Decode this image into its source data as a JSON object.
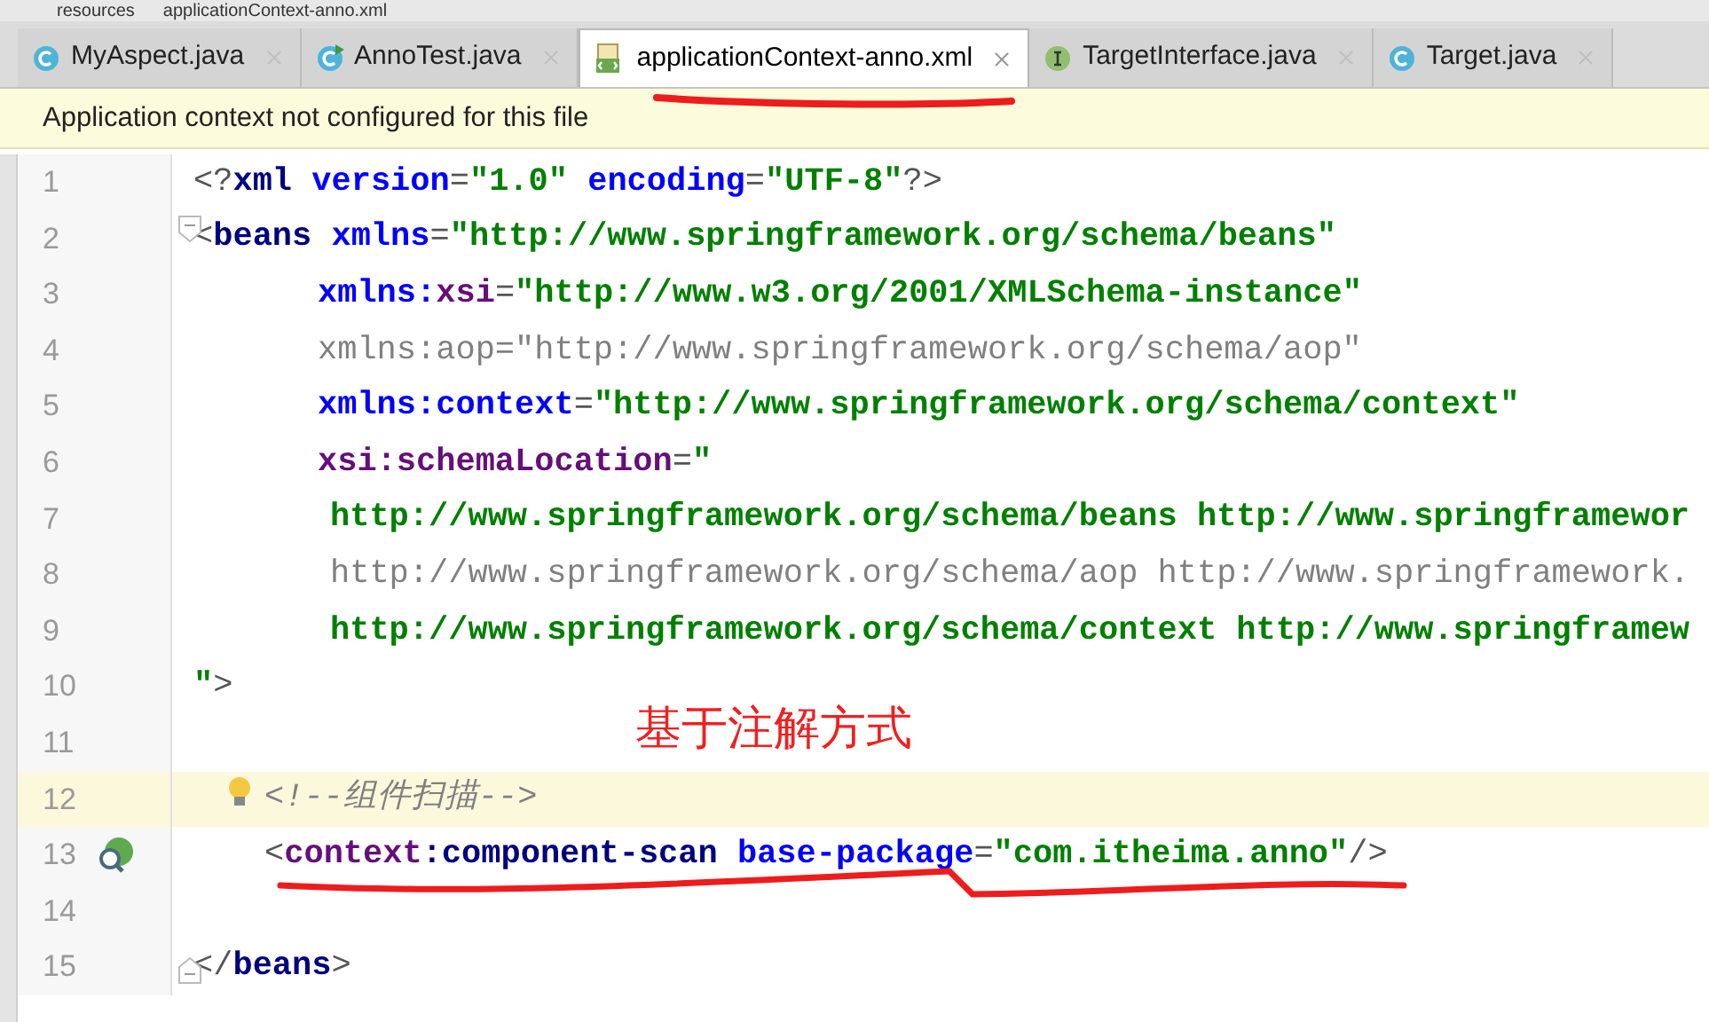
{
  "breadcrumb": [
    "resources",
    "applicationContext-anno.xml"
  ],
  "tabs": [
    {
      "label": "MyAspect.java",
      "kind": "class",
      "selected": false
    },
    {
      "label": "AnnoTest.java",
      "kind": "runnable",
      "selected": false
    },
    {
      "label": "applicationContext-anno.xml",
      "kind": "xml",
      "selected": true
    },
    {
      "label": "TargetInterface.java",
      "kind": "interface",
      "selected": false
    },
    {
      "label": "Target.java",
      "kind": "class",
      "selected": false
    }
  ],
  "banner": "Application context not configured for this file",
  "lines": [
    {
      "number": "1",
      "current": false,
      "segments": [
        {
          "kind": "punct",
          "text": "<?"
        },
        {
          "kind": "tag",
          "text": "xml"
        },
        {
          "kind": "attr",
          "text": " version"
        },
        {
          "kind": "punct",
          "text": "="
        },
        {
          "kind": "value",
          "text": "\"1.0\""
        },
        {
          "kind": "attr",
          "text": " encoding"
        },
        {
          "kind": "punct",
          "text": "="
        },
        {
          "kind": "value",
          "text": "\"UTF-8\""
        },
        {
          "kind": "punct",
          "text": "?>"
        }
      ]
    },
    {
      "number": "2",
      "current": false,
      "kind": "fold",
      "segments": [
        {
          "kind": "punct",
          "text": "<"
        },
        {
          "kind": "tag",
          "text": "beans"
        },
        {
          "kind": "attr",
          "text": " xmlns"
        },
        {
          "kind": "punct",
          "text": "="
        },
        {
          "kind": "value",
          "text": "\"http://www.springframework.org/schema/beans\""
        }
      ]
    },
    {
      "number": "3",
      "current": false,
      "segments": [
        {
          "kind": "attr",
          "text": "xmlns:"
        },
        {
          "kind": "ns",
          "text": "xsi"
        },
        {
          "kind": "punct",
          "text": "="
        },
        {
          "kind": "value",
          "text": "\"http://www.w3.org/2001/XMLSchema-instance\""
        }
      ]
    },
    {
      "number": "4",
      "current": false,
      "segments": [
        {
          "kind": "dim",
          "text": "xmlns:aop=\"http://www.springframework.org/schema/aop\""
        }
      ]
    },
    {
      "number": "5",
      "current": false,
      "segments": [
        {
          "kind": "attr",
          "text": "xmlns:context"
        },
        {
          "kind": "punct",
          "text": "="
        },
        {
          "kind": "value",
          "text": "\"http://www.springframework.org/schema/context\""
        }
      ]
    },
    {
      "number": "6",
      "current": false,
      "segments": [
        {
          "kind": "ns",
          "text": "xsi:schemaLocation"
        },
        {
          "kind": "punct",
          "text": "="
        },
        {
          "kind": "value",
          "text": "\""
        }
      ]
    },
    {
      "number": "7",
      "current": false,
      "segments": [
        {
          "kind": "value",
          "text": "http://www.springframework.org/schema/beans http://www.springframewor"
        }
      ]
    },
    {
      "number": "8",
      "current": false,
      "segments": [
        {
          "kind": "dim",
          "text": "http://www.springframework.org/schema/aop http://www.springframework."
        }
      ]
    },
    {
      "number": "9",
      "current": false,
      "segments": [
        {
          "kind": "value",
          "text": "http://www.springframework.org/schema/context http://www.springframew"
        }
      ]
    },
    {
      "number": "10",
      "current": false,
      "segments": [
        {
          "kind": "value",
          "text": "\""
        },
        {
          "kind": "punct",
          "text": ">"
        }
      ]
    },
    {
      "number": "11",
      "current": false
    },
    {
      "number": "12",
      "current": true,
      "kind": "bulb",
      "segments": [
        {
          "kind": "comment",
          "text": "<!--组件扫描-->"
        }
      ]
    },
    {
      "number": "13",
      "current": false,
      "kind": "bean",
      "segments": [
        {
          "kind": "punct",
          "text": "<"
        },
        {
          "kind": "ns",
          "text": "context"
        },
        {
          "kind": "tag",
          "text": ":component-scan"
        },
        {
          "kind": "attr",
          "text": " base-package"
        },
        {
          "kind": "punct",
          "text": "="
        },
        {
          "kind": "value",
          "text": "\"com.itheima.anno\""
        },
        {
          "kind": "punct",
          "text": "/>"
        }
      ]
    },
    {
      "number": "14",
      "current": false
    },
    {
      "number": "15",
      "current": false,
      "kind": "fold_end",
      "segments": [
        {
          "kind": "punct",
          "text": "</"
        },
        {
          "kind": "tag",
          "text": "beans"
        },
        {
          "kind": "punct",
          "text": ">"
        }
      ]
    }
  ],
  "annotation": "基于注解方式"
}
